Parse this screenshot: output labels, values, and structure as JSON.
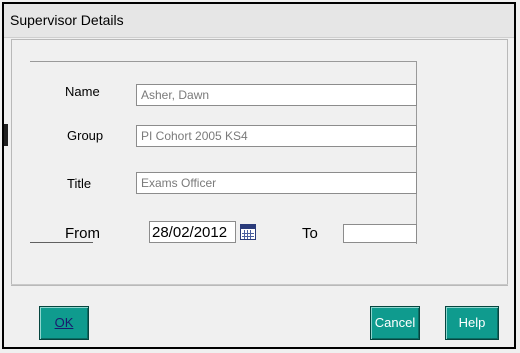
{
  "window": {
    "title": "Supervisor Details"
  },
  "form": {
    "name_label": "Name",
    "name_value": "Asher, Dawn",
    "group_label": "Group",
    "group_value": "PI Cohort 2005 KS4",
    "title_label": "Title",
    "title_value": "Exams Officer",
    "from_label": "From",
    "from_value": "28/02/2012",
    "to_label": "To",
    "to_value": ""
  },
  "buttons": {
    "ok": "OK",
    "cancel": "Cancel",
    "help": "Help"
  },
  "icons": {
    "calendar": "calendar-icon"
  },
  "colors": {
    "button_bg": "#0f9b8e",
    "field_text": "#7a7a7a"
  }
}
